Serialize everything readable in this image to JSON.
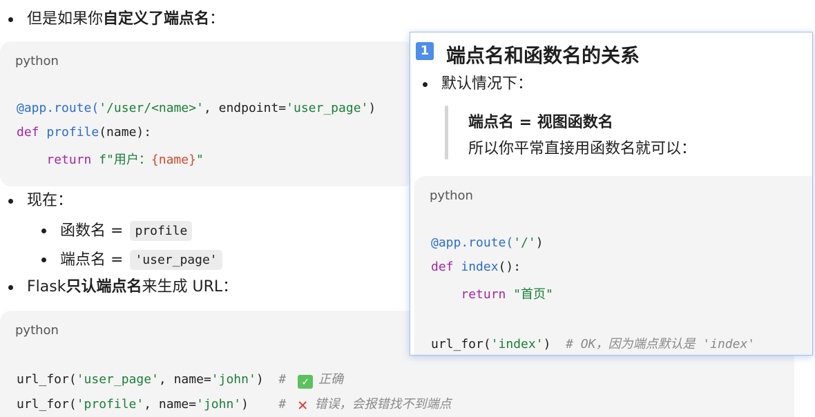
{
  "bullets": {
    "custom_prefix": "但是如果你",
    "custom_bold": "自定义了端点名",
    "custom_suffix": "：",
    "now": "现在：",
    "func_name_label": "函数名 =",
    "func_name_value": "profile",
    "endpoint_label": "端点名 =",
    "endpoint_value": "'user_page'",
    "flask_prefix": "Flask ",
    "flask_bold": "只认端点名",
    "flask_suffix": " 来生成 URL："
  },
  "code_block_1": {
    "lang": "python",
    "line1_deco": "@app.route(",
    "line1_str": "'/user/<name>'",
    "line1_mid": ", endpoint=",
    "line1_str2": "'user_page'",
    "line1_end": ")",
    "line2_kw": "def ",
    "line2_fn": "profile",
    "line2_rest": "(name):",
    "line3_kw": "return ",
    "line3_str": "f\"用户：",
    "line3_interp": "{name}",
    "line3_end": "\""
  },
  "code_block_2": {
    "lang": "python",
    "line1_a": "url_for(",
    "line1_str": "'user_page'",
    "line1_b": ", name=",
    "line1_str2": "'john'",
    "line1_c": ")",
    "line1_comment_hash": "# ",
    "line1_comment_text": "正确",
    "line2_a": "url_for(",
    "line2_str": "'profile'",
    "line2_b": ", name=",
    "line2_str2": "'john'",
    "line2_c": ")",
    "line2_comment_hash": "# ",
    "line2_comment_text": "错误，会报错找不到端点"
  },
  "popup": {
    "badge": "1",
    "title": "端点名和函数名的关系",
    "bullet": "默认情况下：",
    "quote_bold": "端点名 = 视图函数名",
    "quote_text": "所以你平常直接用函数名就可以：",
    "code": {
      "lang": "python",
      "line1_deco": "@app.route(",
      "line1_str": "'/'",
      "line1_end": ")",
      "line2_kw": "def ",
      "line2_fn": "index",
      "line2_rest": "():",
      "line3_kw": "return ",
      "line3_str": "\"首页\"",
      "line4_a": "url_for(",
      "line4_str": "'index'",
      "line4_b": ")",
      "line4_comment": "# OK，因为端点默认是 'index'"
    }
  },
  "icons": {
    "check": "check-mark-icon",
    "cross": "cross-mark-icon"
  }
}
